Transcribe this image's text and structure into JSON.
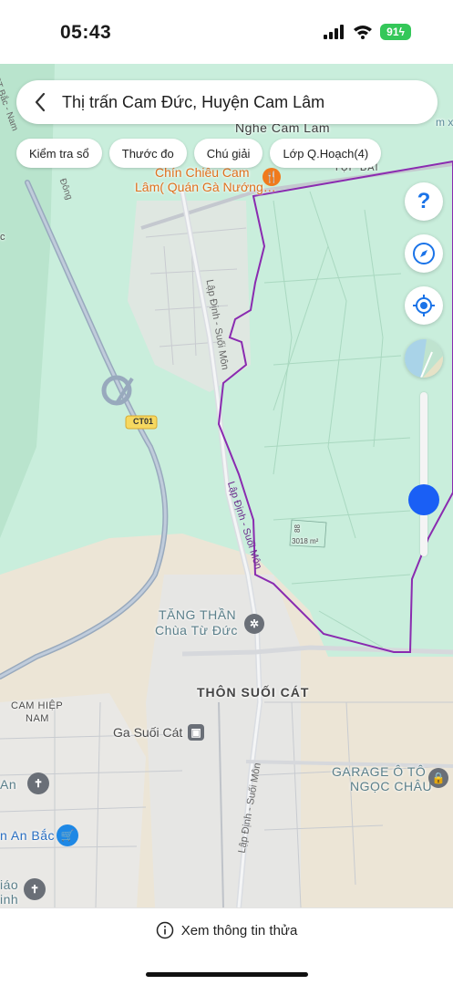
{
  "status_bar": {
    "time": "05:43",
    "battery": "91"
  },
  "header": {
    "title": "Thị trấn Cam Đức, Huyện Cam Lâm"
  },
  "chips": [
    "Kiểm tra sổ",
    "Thước đo",
    "Chú giải",
    "Lớp Q.Hoạch(4)"
  ],
  "map": {
    "labels": {
      "nghe_cam_lam": "Nghe Cam Lam",
      "chin_chieu_1": "Chín Chiêu Cam",
      "chin_chieu_2": "Lâm( Quán Gà Nướng…",
      "top_bai": "TỤP BÃI",
      "road_ct01": "CT01",
      "lap_dinh_suoi_mon_1": "Lập Định - Suối Môn",
      "lap_dinh_suoi_mon_2": "Lập Định - Suối Môn",
      "lap_dinh_suoi_mon_3": "Lập Định - Suối Môn",
      "parcel_number": "88",
      "parcel_area": "3018 m²",
      "tang_than": "TĂNG THẦN",
      "chua_tu_duc": "Chùa Từ Đức",
      "thon_suoi_cat": "THÔN SUỐI CÁT",
      "cam_hiep_nam_1": "CAM HIỆP",
      "cam_hiep_nam_2": "NAM",
      "ga_suoi_cat": "Ga Suối Cát",
      "garage_1": "GARAGE Ô TÔ",
      "garage_2": "NGỌC CHÂU",
      "an_left": "An",
      "an_bac": "n An Bắc",
      "giao": "iáo",
      "inh": "inh",
      "left_c": "c",
      "highway_left": "Đông",
      "highway_top": "CT Bắc - Nam",
      "top_right": "m x"
    }
  },
  "bottom": {
    "parcel_info": "Xem thông tin thửa"
  },
  "colors": {
    "boundary": "#8a2bb0",
    "map_green": "#c9eedc",
    "urban": "#ece9e2",
    "highway": "#98a9bd",
    "slider_knob": "#1a5ff5",
    "battery": "#34c759",
    "poi_orange": "#f07a1d",
    "poi_grey": "#6a6f77",
    "poi_blue": "#1e88e5"
  },
  "icons": [
    "back-icon",
    "help-icon",
    "compass-icon",
    "my-location-icon",
    "layer-icon",
    "info-icon",
    "signal-icon",
    "wifi-icon"
  ]
}
